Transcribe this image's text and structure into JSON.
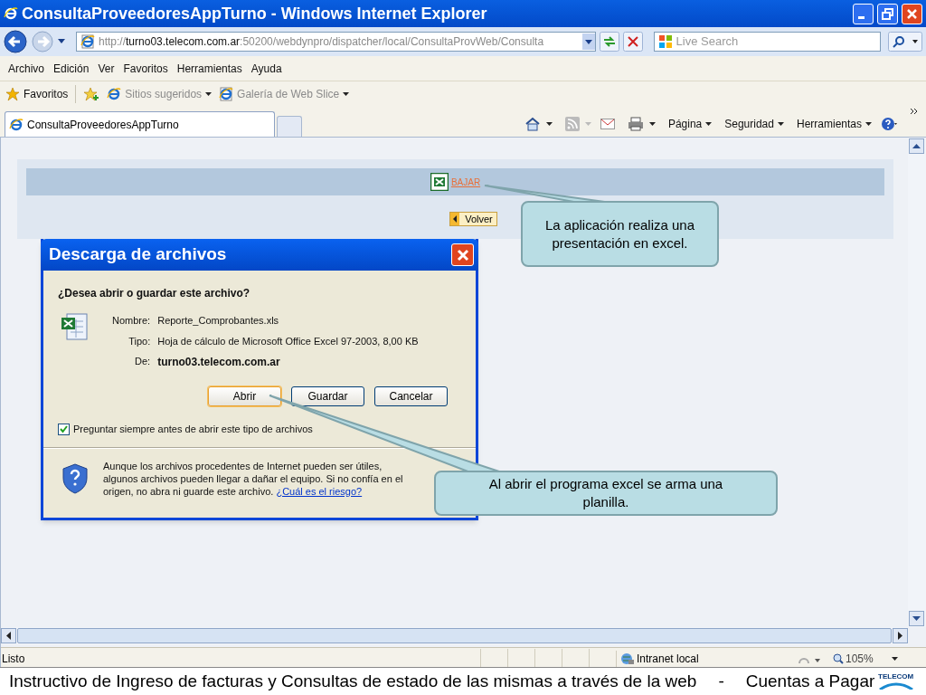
{
  "window": {
    "title": "ConsultaProveedoresAppTurno - Windows Internet Explorer"
  },
  "address": {
    "url_parts": [
      {
        "text": "http://",
        "emphasized": false
      },
      {
        "text": "turno03.telecom.com.ar",
        "emphasized": true
      },
      {
        "text": ":50200/webdynpro/dispatcher/local/ConsultaProvWeb/Consulta",
        "emphasized": false
      }
    ]
  },
  "search": {
    "placeholder": "Live Search"
  },
  "menu": [
    "Archivo",
    "Edición",
    "Ver",
    "Favoritos",
    "Herramientas",
    "Ayuda"
  ],
  "favorites_bar": {
    "label": "Favoritos",
    "links": [
      "Sitios sugeridos",
      "Galería de Web Slice"
    ]
  },
  "tabs": [
    {
      "label": "ConsultaProveedoresAppTurno",
      "selected": true
    }
  ],
  "command_bar": [
    "Página",
    "Seguridad",
    "Herramientas"
  ],
  "page": {
    "download_link": "BAJAR",
    "back_button": "Volver"
  },
  "dialog": {
    "title": "Descarga de archivos",
    "question": "¿Desea abrir o guardar este archivo?",
    "fields": [
      {
        "label": "Nombre:",
        "value": "Reporte_Comprobantes.xls",
        "emphasized": false
      },
      {
        "label": "Tipo:",
        "value": "Hoja de cálculo de Microsoft Office Excel 97-2003, 8,00 KB",
        "emphasized": false
      },
      {
        "label": "De:",
        "value": "turno03.telecom.com.ar",
        "emphasized": true
      }
    ],
    "buttons": [
      {
        "label": "Abrir",
        "selected": true
      },
      {
        "label": "Guardar",
        "selected": false
      },
      {
        "label": "Cancelar",
        "selected": false
      }
    ],
    "checkbox": {
      "label": "Preguntar siempre antes de abrir este tipo de archivos",
      "checked": true
    },
    "warning": "Aunque los archivos procedentes de Internet pueden ser útiles, algunos archivos pueden llegar a dañar el equipo. Si no confía en el origen, no abra ni guarde este archivo.",
    "warning_link": "¿Cuál es el riesgo?"
  },
  "callouts": [
    "La aplicación realiza una presentación en excel.",
    "Al abrir el programa excel se arma una planilla."
  ],
  "status_bar": {
    "text": "Listo",
    "zone": "Intranet local",
    "zoom": "105%"
  },
  "footer": {
    "text": "Instructivo de Ingreso de facturas y Consultas de estado de las mismas a través de la web",
    "separator": "-",
    "section": "Cuentas a Pagar",
    "logo": "TELECOM"
  }
}
